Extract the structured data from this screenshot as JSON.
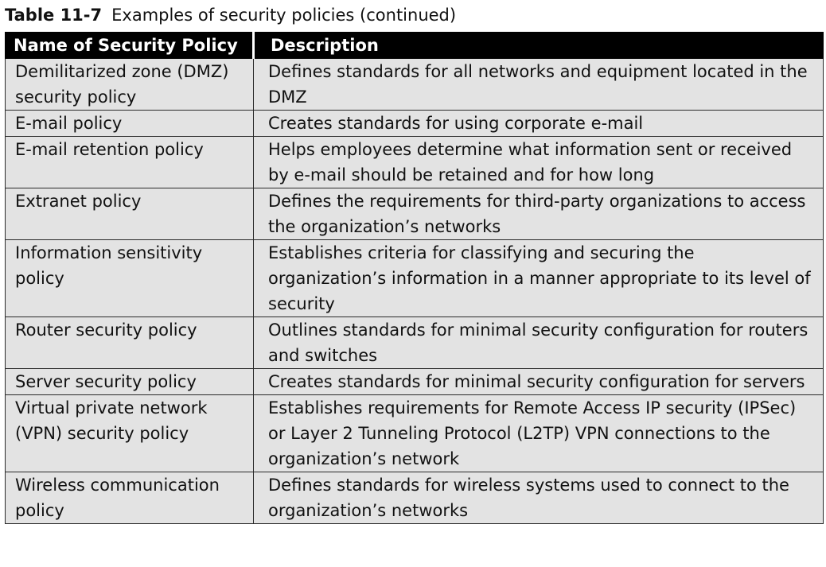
{
  "caption": {
    "label": "Table 11-7",
    "title": "Examples of security policies (continued)"
  },
  "table": {
    "headers": [
      "Name of Security Policy",
      "Description"
    ],
    "rows": [
      {
        "name": "Demilitarized zone (DMZ) security policy",
        "description": "Defines standards for all networks and equipment located in the DMZ"
      },
      {
        "name": "E-mail policy",
        "description": "Creates standards for using corporate e-mail"
      },
      {
        "name": "E-mail retention policy",
        "description": "Helps employees determine what information sent or received by e-mail should be retained and for how long"
      },
      {
        "name": "Extranet policy",
        "description": "Defines the requirements for third-party organizations to access the organization’s networks"
      },
      {
        "name": "Information sensitivity policy",
        "description": "Establishes criteria for classifying and securing the organization’s information in a manner appropriate to its level of security"
      },
      {
        "name": "Router security policy",
        "description": "Outlines standards for minimal security configuration for routers and switches"
      },
      {
        "name": "Server security policy",
        "description": "Creates standards for minimal security configuration for servers"
      },
      {
        "name": "Virtual private network (VPN) security policy",
        "description": "Establishes requirements for Remote Access IP security (IPSec) or Layer 2 Tunneling Protocol (L2TP) VPN connections to the organization’s network"
      },
      {
        "name": "Wireless communication policy",
        "description": "Defines standards for wireless systems used to connect to the organization’s networks"
      }
    ]
  },
  "colors": {
    "header_bg": "#000000",
    "header_text": "#ffffff",
    "cell_bg": "#e3e3e3",
    "grid_line": "#2a2a2a"
  }
}
